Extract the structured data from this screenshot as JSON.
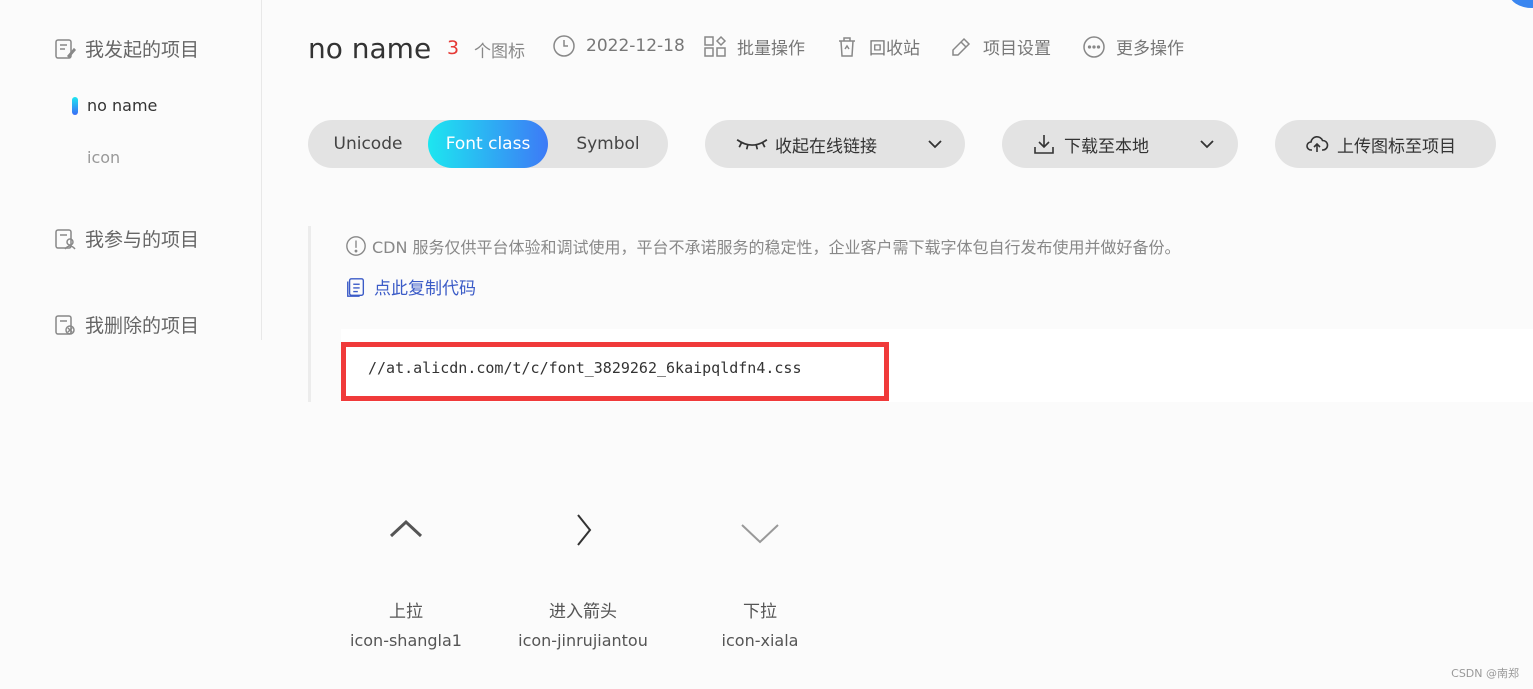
{
  "sidebar": {
    "my_projects": "我发起的项目",
    "my_projects_items": [
      "no name",
      "icon"
    ],
    "participated": "我参与的项目",
    "deleted": "我删除的项目"
  },
  "header": {
    "title": "no name",
    "icon_count": "3",
    "icon_count_suffix": "个图标",
    "date": "2022-12-18",
    "batch": "批量操作",
    "recycle": "回收站",
    "settings": "项目设置",
    "more": "更多操作"
  },
  "toolbar": {
    "tabs": [
      "Unicode",
      "Font class",
      "Symbol"
    ],
    "active_tab": "Font class",
    "collapse_link": "收起在线链接",
    "download": "下载至本地",
    "upload": "上传图标至项目"
  },
  "cdn": {
    "notice": "CDN 服务仅供平台体验和调试使用，平台不承诺服务的稳定性，企业客户需下载字体包自行发布使用并做好备份。",
    "copy_code": "点此复制代码",
    "url": "//at.alicdn.com/t/c/font_3829262_6kaipqldfn4.css"
  },
  "icons": [
    {
      "glyph": "chevron-up-icon",
      "name": "上拉",
      "code": "icon-shangla1"
    },
    {
      "glyph": "chevron-right-icon",
      "name": "进入箭头",
      "code": "icon-jinrujiantou"
    },
    {
      "glyph": "chevron-down-icon",
      "name": "下拉",
      "code": "icon-xiala"
    }
  ],
  "watermark": "CSDN @南郑",
  "colors": {
    "accent_start": "#1de6f0",
    "accent_end": "#3d7af6",
    "count_red": "#e53935",
    "highlight_red": "#f03a3a",
    "link_blue": "#3b5bc7"
  }
}
